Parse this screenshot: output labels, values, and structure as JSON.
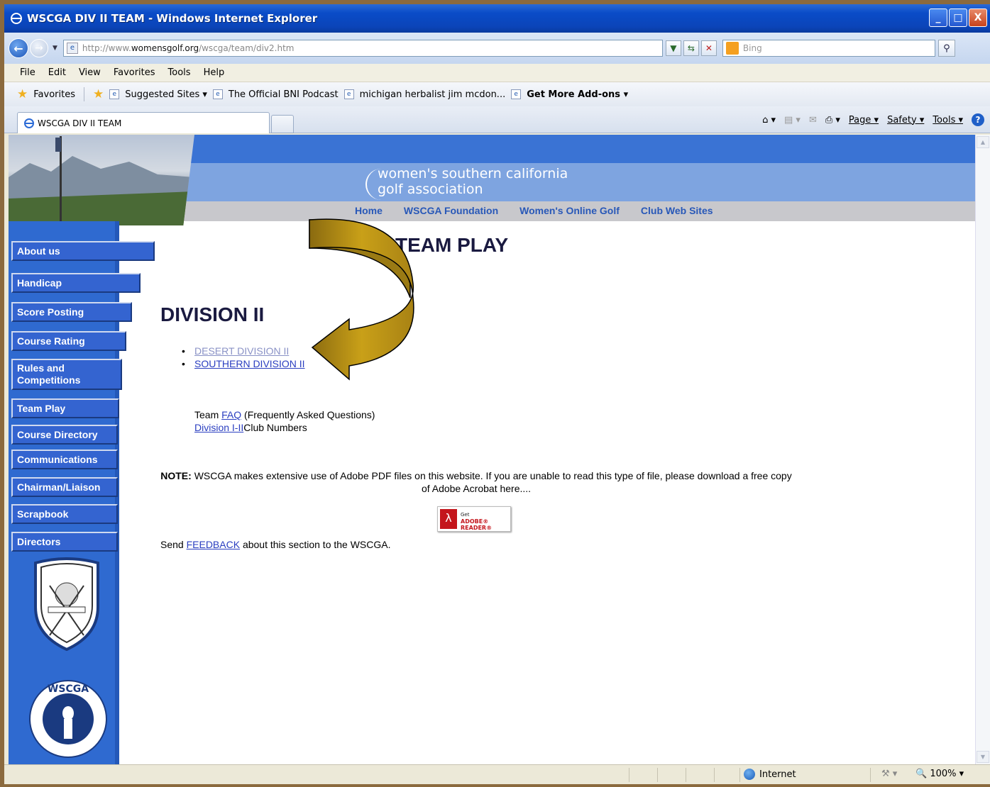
{
  "window": {
    "title": "WSCGA DIV II TEAM - Windows Internet Explorer",
    "controls": [
      "_",
      "□",
      "X"
    ]
  },
  "address": {
    "url_prefix": "http://www.",
    "url_domain": "womensgolf.org",
    "url_path": "/wscga/team/div2.htm",
    "search_placeholder": "Bing"
  },
  "menu": [
    "File",
    "Edit",
    "View",
    "Favorites",
    "Tools",
    "Help"
  ],
  "favorites_bar": {
    "favorites": "Favorites",
    "items": [
      "Suggested Sites ▾",
      "The Official BNI Podcast",
      "michigan herbalist jim mcdon...",
      "Get More Add-ons ▾"
    ]
  },
  "tab": {
    "label": "WSCGA DIV II TEAM"
  },
  "command_bar": {
    "page": "Page ▾",
    "safety": "Safety ▾",
    "tools": "Tools ▾"
  },
  "site": {
    "brand_line1": "women's southern california",
    "brand_line2": "golf association",
    "nav": [
      "Home",
      "WSCGA Foundation",
      "Women's Online Golf",
      "Club Web Sites"
    ],
    "sidebar": [
      "About us",
      "Handicap",
      "Score Posting",
      "Course Rating",
      "Rules and",
      "Competitions",
      "Team Play",
      "Course Directory",
      "Communications",
      "Chairman/Liaison",
      "Scrapbook",
      "Directors"
    ]
  },
  "content": {
    "heading": "TEAM PLAY",
    "subheading": "DIVISION II",
    "links": [
      "DESERT DIVISION II",
      "SOUTHERN DIVISION II"
    ],
    "faq_prefix": "Team",
    "faq_link": "FAQ",
    "faq_suffix": "(Frequently Asked Questions)",
    "clubs_link": "Division I-II",
    "clubs_suffix": "Club Numbers",
    "note_label": "NOTE:",
    "note_text": "WSCGA makes extensive use of Adobe PDF files on this website. If you are unable to read this type of file, please download a free copy of Adobe Acrobat here....",
    "adobe_get": "Get",
    "adobe_reader": "ADOBE® READER®",
    "feedback_prefix": "Send",
    "feedback_link": "FEEDBACK",
    "feedback_suffix": "about this section to the WSCGA."
  },
  "status": {
    "zone": "Internet",
    "zoom": "100%"
  },
  "colors": {
    "site_blue": "#3a73d4",
    "band_blue": "#7ea4e0",
    "arrow_gold": "#c9a018"
  }
}
